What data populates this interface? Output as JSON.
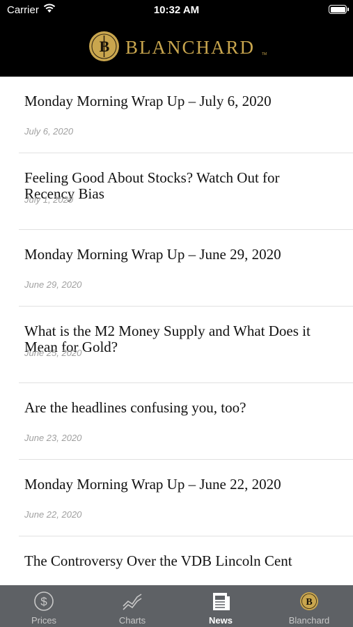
{
  "status": {
    "carrier": "Carrier",
    "time": "10:32 AM"
  },
  "header": {
    "brand": "BLANCHARD",
    "trademark": "TM",
    "logo_letter": "B"
  },
  "articles": [
    {
      "title": "Monday Morning Wrap Up – July 6, 2020",
      "date": "July 6, 2020"
    },
    {
      "title": "Feeling Good About Stocks? Watch Out for Recency Bias",
      "date": "July 1, 2020"
    },
    {
      "title": "Monday Morning Wrap Up – June 29, 2020",
      "date": "June 29, 2020"
    },
    {
      "title": "What is the M2 Money Supply and What Does it Mean for Gold?",
      "date": "June 25, 2020"
    },
    {
      "title": "Are the headlines confusing you, too?",
      "date": "June 23, 2020"
    },
    {
      "title": "Monday Morning Wrap Up – June 22, 2020",
      "date": "June 22, 2020"
    },
    {
      "title": "The Controversy Over the VDB Lincoln Cent",
      "date": ""
    }
  ],
  "tabs": [
    {
      "label": "Prices",
      "icon": "dollar-circle-icon"
    },
    {
      "label": "Charts",
      "icon": "line-chart-icon"
    },
    {
      "label": "News",
      "icon": "newspaper-icon",
      "active": true
    },
    {
      "label": "Blanchard",
      "icon": "blanchard-logo-icon"
    }
  ],
  "colors": {
    "gold": "#c9a64e",
    "tabbar": "#5e6165",
    "date": "#a0a0a0"
  }
}
